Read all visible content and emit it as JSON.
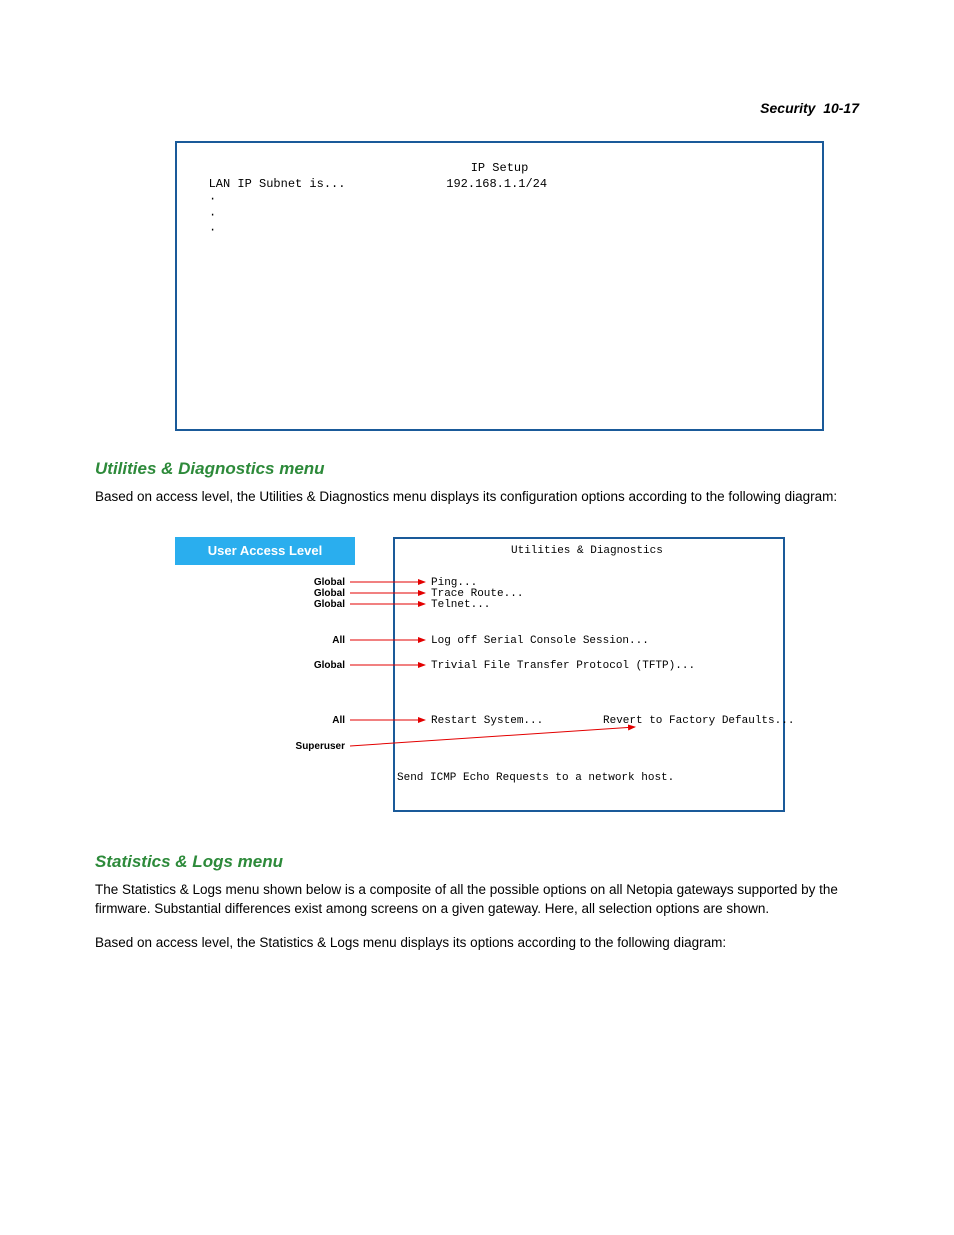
{
  "header": {
    "section": "Security",
    "page": "10-17"
  },
  "terminal": {
    "title": "IP Setup",
    "line1_label": "LAN IP Subnet is...",
    "line1_value": "192.168.1.1/24",
    "dots": [
      "·",
      "·",
      "·"
    ]
  },
  "section1": {
    "heading": "Utilities & Diagnostics menu",
    "paragraph": "Based on access level, the Utilities & Diagnostics menu displays its configuration options according to the following diagram:"
  },
  "diagram": {
    "user_access_label": "User Access Level",
    "menu_title": "Utilities & Diagnostics",
    "rows": [
      {
        "access": "Global",
        "item": "Ping..."
      },
      {
        "access": "Global",
        "item": "Trace Route..."
      },
      {
        "access": "Global",
        "item": "Telnet..."
      },
      {
        "access": "All",
        "item": "Log off Serial Console Session..."
      },
      {
        "access": "Global",
        "item": "Trivial File Transfer Protocol (TFTP)..."
      },
      {
        "access": "All",
        "item": "Restart System..."
      },
      {
        "access": "Superuser",
        "item": "Revert to Factory Defaults..."
      }
    ],
    "hint": "Send ICMP Echo Requests to a network host."
  },
  "section2": {
    "heading": "Statistics & Logs menu",
    "paragraph1": "The Statistics & Logs menu shown below is a composite of all the possible options on all Netopia gateways supported by the firmware. Substantial differences exist among screens on a given gateway. Here, all selection options are shown.",
    "paragraph2": "Based on access level, the Statistics & Logs menu displays its options according to the following diagram:"
  }
}
